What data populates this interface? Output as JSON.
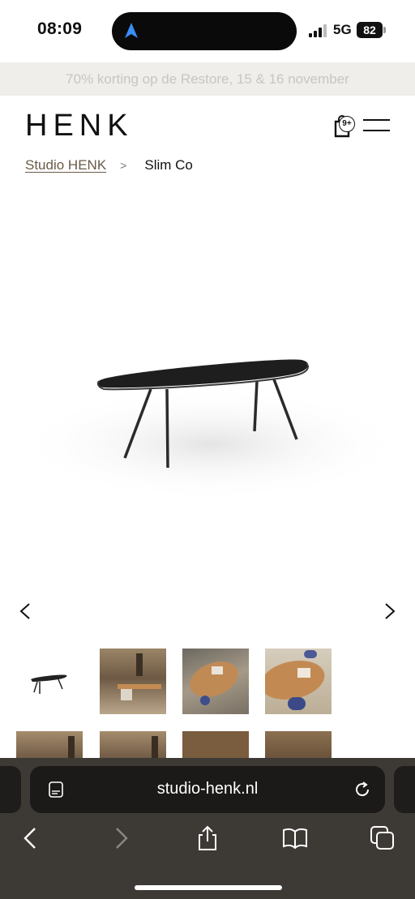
{
  "status_bar": {
    "time": "08:09",
    "network": "5G",
    "battery": "82"
  },
  "promo": {
    "text": "70% korting op de Restore, 15 & 16 november"
  },
  "header": {
    "logo": "HENK",
    "cart_badge": "9+"
  },
  "breadcrumb": {
    "parent": "Studio HENK",
    "separator": ">",
    "current": "Slim Co"
  },
  "product": {
    "image": "black oval table on slim legs"
  },
  "thumbnails": [
    {
      "kind": "black-table"
    },
    {
      "kind": "room-desk"
    },
    {
      "kind": "oval-table-top"
    },
    {
      "kind": "oval-table-angle"
    },
    {
      "kind": "room-wall"
    },
    {
      "kind": "room-wall"
    },
    {
      "kind": "wood"
    },
    {
      "kind": "wood"
    }
  ],
  "browser": {
    "url": "studio-henk.nl"
  },
  "colors": {
    "promo_bg": "#efeeea",
    "breadcrumb_link": "#6b5a47",
    "safari_bar": "#3d3a36"
  }
}
